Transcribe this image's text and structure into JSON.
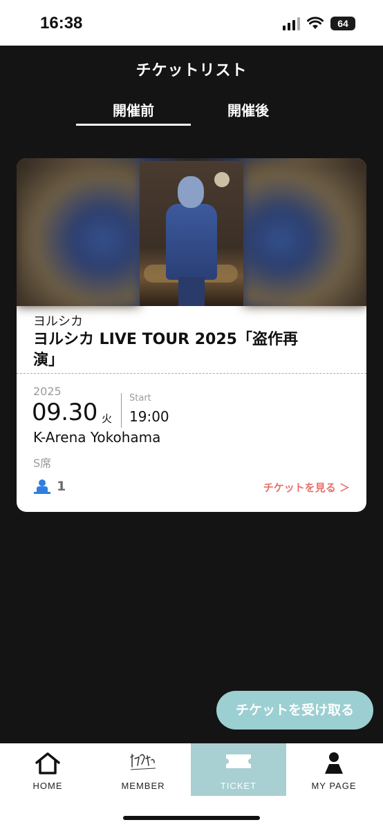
{
  "status_bar": {
    "time": "16:38",
    "battery": "64"
  },
  "header": {
    "title": "チケットリスト"
  },
  "tabs": [
    {
      "label": "開催前",
      "active": true
    },
    {
      "label": "開催後",
      "active": false
    }
  ],
  "ticket": {
    "artist": "ヨルシカ",
    "title": "ヨルシカ LIVE TOUR 2025「盗作再演」",
    "year": "2025",
    "date": "09.30",
    "weekday": "火",
    "start_label": "Start",
    "start_time": "19:00",
    "venue": "K-Arena Yokohama",
    "seat": "S席",
    "count": "1",
    "view_label": "チケットを見る ＞"
  },
  "fab": {
    "label": "チケットを受け取る"
  },
  "bottom_nav": [
    {
      "label": "HOME",
      "icon": "home-icon"
    },
    {
      "label": "MEMBER",
      "icon": "signature-icon"
    },
    {
      "label": "TICKET",
      "icon": "ticket-icon",
      "active": true
    },
    {
      "label": "MY PAGE",
      "icon": "person-icon"
    }
  ],
  "colors": {
    "background": "#141414",
    "accent_link": "#e8706a",
    "fab": "#9ccfd2",
    "nav_active": "#a8cfd1",
    "person_icon": "#2f7ee0"
  }
}
